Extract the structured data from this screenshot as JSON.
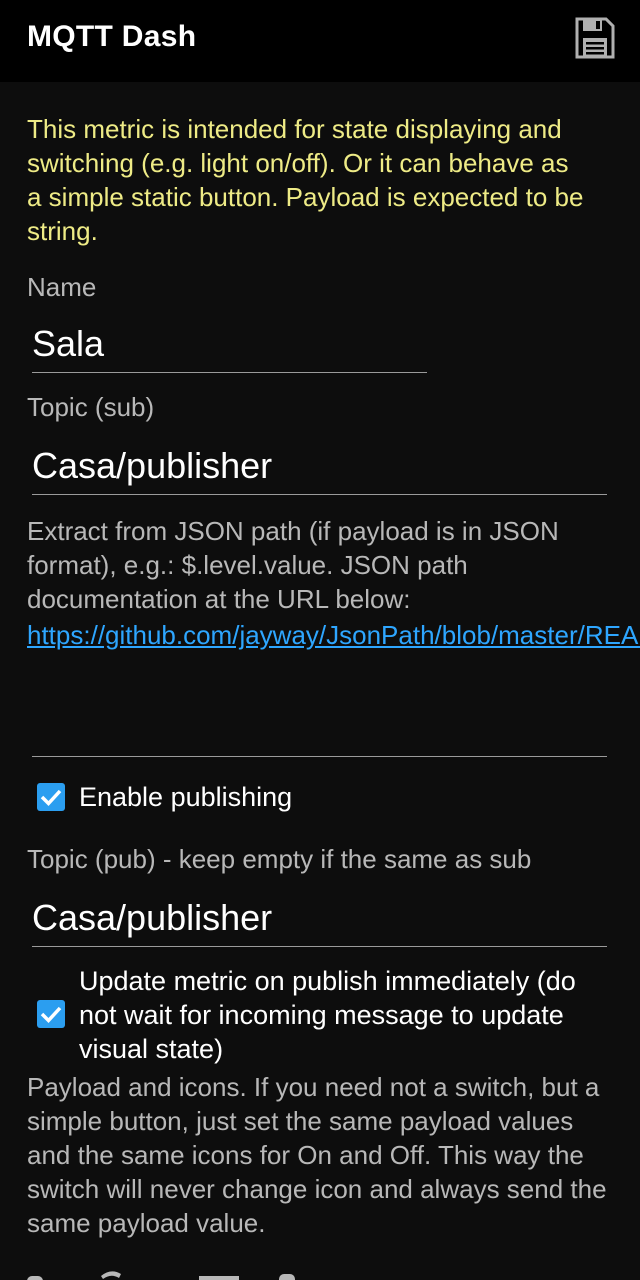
{
  "appbar": {
    "title": "MQTT Dash",
    "save_icon": "save-icon"
  },
  "form": {
    "info_text": "This metric is intended for state displaying and switching (e.g. light on/off). Or it can behave as a simple static button. Payload is expected to be string.",
    "name_label": "Name",
    "name_value": "Sala",
    "topic_sub_label": "Topic (sub)",
    "topic_sub_value": "Casa/publisher",
    "json_help": "Extract from JSON path (if payload is in JSON format), e.g.: $.level.value. JSON path documentation at the URL below:",
    "json_link": "https://github.com/jayway/JsonPath/blob/master/README.md",
    "json_path_value": "",
    "enable_publishing_label": "Enable publishing",
    "enable_publishing_checked": true,
    "topic_pub_label": "Topic (pub) - keep empty if the same as sub",
    "topic_pub_value": "Casa/publisher",
    "update_immediately_label": "Update metric on publish immediately (do not wait for incoming message to update visual state)",
    "update_immediately_checked": true,
    "payload_help": "Payload and icons. If you need not a switch, but a simple button, just set the same payload values and the same icons for On and Off. This way the switch will never change icon and always send the same payload value."
  },
  "colors": {
    "accent": "#2b9ef0",
    "info_text": "#eeeb86",
    "link": "#2ea6ff",
    "background": "#0d0d0d"
  }
}
